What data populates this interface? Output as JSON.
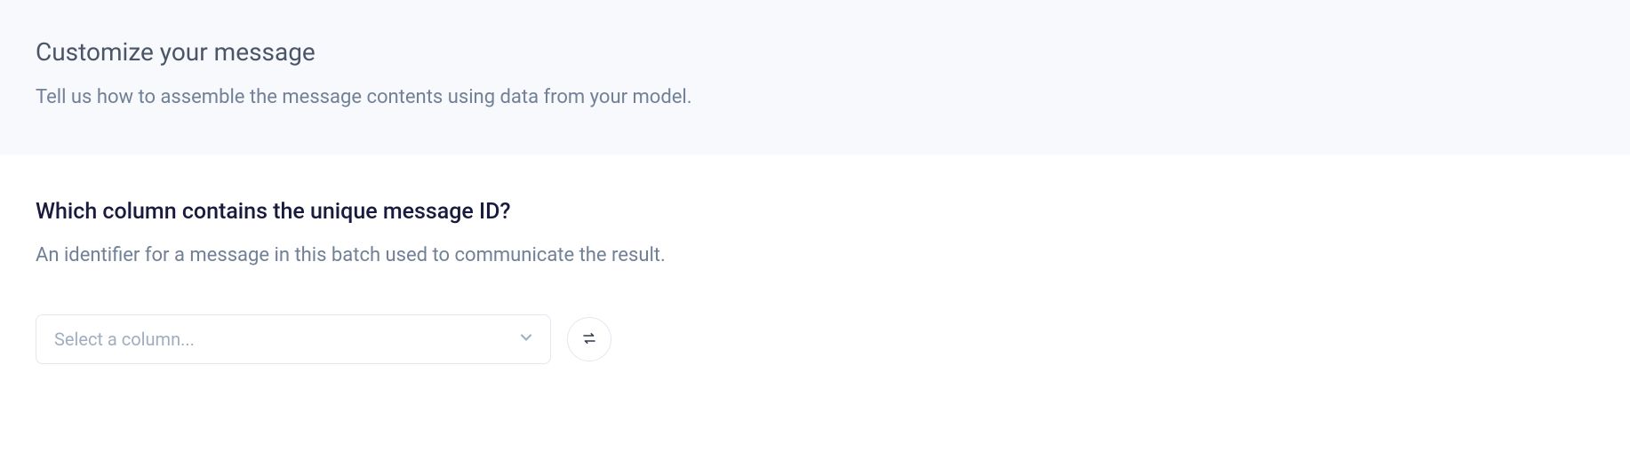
{
  "header": {
    "title": "Customize your message",
    "subtitle": "Tell us how to assemble the message contents using data from your model."
  },
  "question": {
    "title": "Which column contains the unique message ID?",
    "description": "An identifier for a message in this batch used to communicate the result."
  },
  "select": {
    "placeholder": "Select a column..."
  }
}
